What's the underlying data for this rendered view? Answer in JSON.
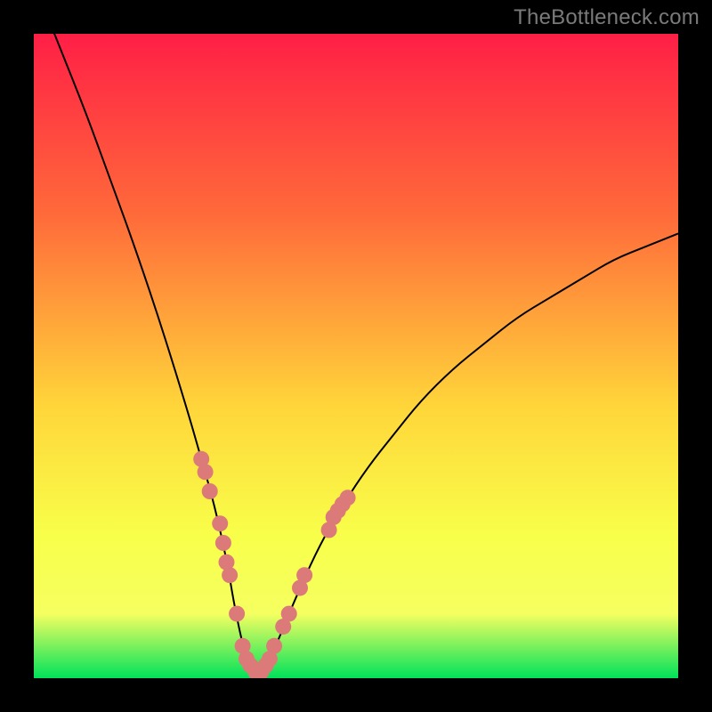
{
  "attribution": "TheBottleneck.com",
  "colors": {
    "black": "#000000",
    "gradient_top": "#ff1f46",
    "gradient_mid1": "#ff6a3a",
    "gradient_mid2": "#ffd63a",
    "gradient_mid3": "#f8ff4a",
    "gradient_bottom_yellow": "#f5ff60",
    "gradient_bottom_green": "#00e25a",
    "curve": "#000000",
    "dots": "#dc7a7a"
  },
  "chart_data": {
    "type": "line",
    "title": "",
    "xlabel": "",
    "ylabel": "",
    "xlim": [
      0,
      100
    ],
    "ylim": [
      0,
      100
    ],
    "series": [
      {
        "name": "bottleneck-curve",
        "x": [
          0,
          4,
          8,
          12,
          16,
          20,
          24,
          26,
          28,
          30,
          31,
          32,
          33,
          34,
          35,
          36,
          38,
          40,
          44,
          48,
          52,
          56,
          60,
          65,
          70,
          75,
          80,
          85,
          90,
          95,
          100
        ],
        "y": [
          108,
          98,
          88,
          77,
          66,
          54,
          41,
          34,
          27,
          18,
          12,
          7,
          3,
          1,
          1,
          2,
          6,
          11,
          20,
          27,
          33,
          38,
          43,
          48,
          52,
          56,
          59,
          62,
          65,
          67,
          69
        ]
      }
    ],
    "scatter": {
      "name": "highlighted-points",
      "points": [
        {
          "x": 26.0,
          "y": 34
        },
        {
          "x": 26.6,
          "y": 32
        },
        {
          "x": 27.3,
          "y": 29
        },
        {
          "x": 28.9,
          "y": 24
        },
        {
          "x": 29.4,
          "y": 21
        },
        {
          "x": 29.9,
          "y": 18
        },
        {
          "x": 30.4,
          "y": 16
        },
        {
          "x": 31.5,
          "y": 10
        },
        {
          "x": 32.4,
          "y": 5
        },
        {
          "x": 33.0,
          "y": 3
        },
        {
          "x": 33.6,
          "y": 2
        },
        {
          "x": 34.4,
          "y": 1
        },
        {
          "x": 35.3,
          "y": 1
        },
        {
          "x": 36.0,
          "y": 2
        },
        {
          "x": 36.6,
          "y": 3
        },
        {
          "x": 37.3,
          "y": 5
        },
        {
          "x": 38.7,
          "y": 8
        },
        {
          "x": 39.6,
          "y": 10
        },
        {
          "x": 41.3,
          "y": 14
        },
        {
          "x": 42.0,
          "y": 16
        },
        {
          "x": 45.8,
          "y": 23
        },
        {
          "x": 46.5,
          "y": 25
        },
        {
          "x": 47.2,
          "y": 26
        },
        {
          "x": 47.9,
          "y": 27
        },
        {
          "x": 48.7,
          "y": 28
        }
      ]
    }
  }
}
